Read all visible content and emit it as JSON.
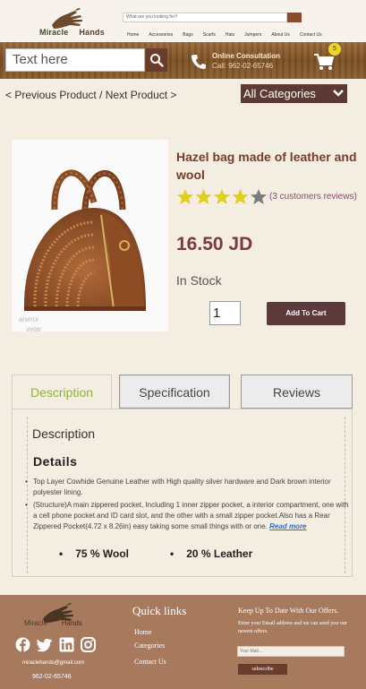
{
  "brand": {
    "name_part1": "Miracle",
    "name_part2": "Hands"
  },
  "header": {
    "search_placeholder": "What are you looking for?",
    "nav": [
      "Home",
      "Accessories",
      "Bags",
      "Scarfs",
      "Hats",
      "Jumpers",
      "About Us",
      "Contact Us"
    ]
  },
  "bar": {
    "search_placeholder": "Text here",
    "consult_title": "Online Consultation",
    "consult_phone": "Call: 962-02-65746",
    "cart_count": "5"
  },
  "pager": {
    "prev": "< Previous Product",
    "sep": " / ",
    "next": "Next Product >"
  },
  "categories": {
    "selected": "All Categories"
  },
  "product": {
    "image_watermark_1": "anemi",
    "image_watermark_2": "yelar",
    "title": "Hazel bag made of leather and wool",
    "rating": 4,
    "rating_max": 5,
    "reviews": "(3 customers reviews)",
    "price": "16.50 JD",
    "stock": "In Stock",
    "quantity": "1",
    "add_to_cart": "Add To Cart"
  },
  "tabs": {
    "description": "Description",
    "specification": "Specification",
    "reviews": "Reviews"
  },
  "description": {
    "heading": "Description",
    "details_heading": "Details",
    "bullet_1": "Top Layer Cowhide Genuine Leather with High quality silver hardware and Dark brown interior polyester lining.",
    "bullet_2": "(Structure)A main zippered pocket, Including 1 inner zipper pocket, a interior compartment, one with a cell phone pocket and ID card slot, and the other with a small zipper pocket.Also has a Rear Zippered Pocket(4.72 x 8.26in) easy taking some small things with or one.",
    "read_more": "Read more",
    "material_1": "75 % Wool",
    "material_2": "20 % Leather"
  },
  "footer": {
    "email": "miraclehands@gmail.com",
    "phone": "962-02-65746",
    "quick_links_title": "Quick links",
    "links": [
      "Home",
      "Categories",
      "Contact Us"
    ],
    "newsletter_title": "Keep Up To Date With Our Offers.",
    "newsletter_text": "Enter your Email address and we can send you our newest offers.",
    "newsletter_placeholder": "Your Mail...",
    "subscribe": "subsicribe"
  },
  "colors": {
    "accent": "#7a3b28",
    "button": "#5c3a3c",
    "footer": "#a77a5e",
    "star": "#e0cf1e",
    "active_tab": "#8fb43a"
  }
}
